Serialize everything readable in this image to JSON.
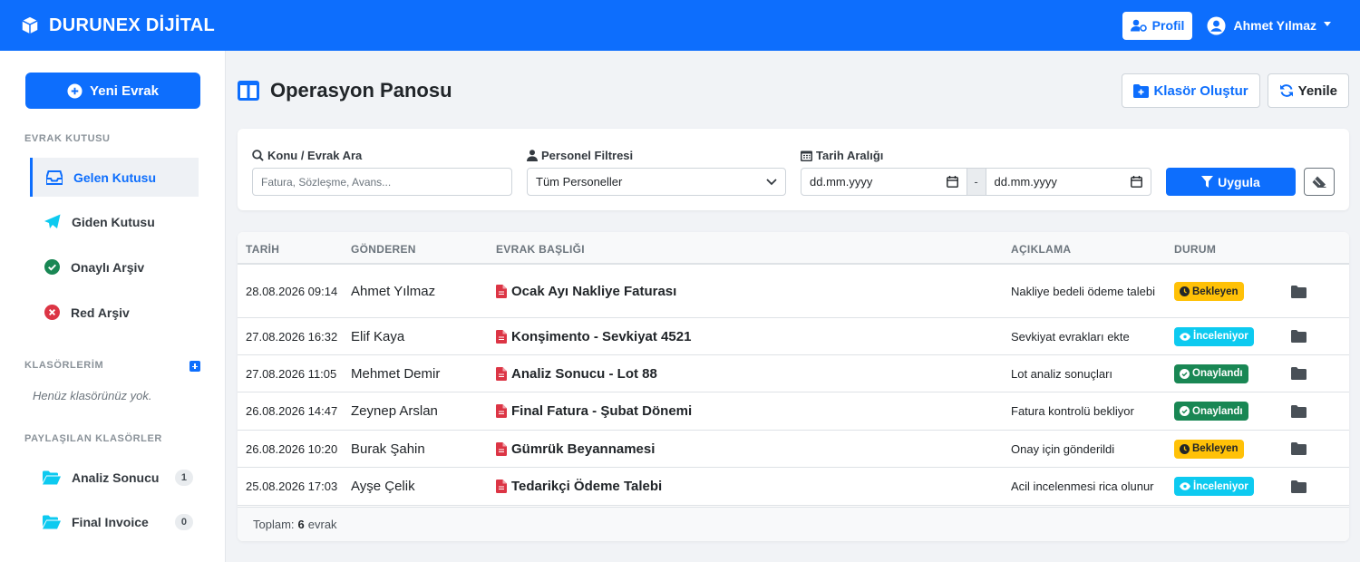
{
  "app": {
    "brand": "DURUNEX DİJİTAL"
  },
  "navbar": {
    "profile_label": "Profil",
    "user_name": "Ahmet Yılmaz"
  },
  "sidebar": {
    "new_doc_label": "Yeni Evrak",
    "inbox_title": "EVRAK KUTUSU",
    "items": [
      {
        "label": "Gelen Kutusu",
        "icon": "inbox-icon"
      },
      {
        "label": "Giden Kutusu",
        "icon": "paper-plane-icon"
      },
      {
        "label": "Onaylı Arşiv",
        "icon": "check-circle-icon"
      },
      {
        "label": "Red Arşiv",
        "icon": "x-circle-icon"
      }
    ],
    "folders_title": "KLASÖRLERİM",
    "folders_empty": "Henüz klasörünüz yok.",
    "shared_title": "PAYLAŞILAN KLASÖRLER",
    "shared": [
      {
        "label": "Analiz Sonucu",
        "count": "1"
      },
      {
        "label": "Final Invoice",
        "count": "0"
      }
    ]
  },
  "main": {
    "title": "Operasyon Panosu",
    "create_folder_label": "Klasör Oluştur",
    "refresh_label": "Yenile"
  },
  "filters": {
    "search_label": "Konu / Evrak Ara",
    "search_placeholder": "Fatura, Sözleşme, Avans...",
    "staff_label": "Personel Filtresi",
    "staff_value": "Tüm Personeller",
    "date_label": "Tarih Aralığı",
    "date_from": "dd.mm.yyyy",
    "date_sep": "-",
    "date_to": "dd.mm.yyyy",
    "apply_label": "Uygula"
  },
  "table": {
    "headers": {
      "date": "TARİH",
      "sender": "GÖNDEREN",
      "title": "EVRAK BAŞLIĞI",
      "desc": "AÇIKLAMA",
      "status": "DURUM"
    },
    "rows": [
      {
        "date": "28.08.2026 09:14",
        "sender": "Ahmet Yılmaz",
        "title": "Ocak Ayı Nakliye Faturası",
        "desc": "Nakliye bedeli ödeme talebi",
        "status": "Bekleyen"
      },
      {
        "date": "27.08.2026 16:32",
        "sender": "Elif Kaya",
        "title": "Konşimento - Sevkiyat 4521",
        "desc": "Sevkiyat evrakları ekte",
        "status": "İnceleniyor"
      },
      {
        "date": "27.08.2026 11:05",
        "sender": "Mehmet Demir",
        "title": "Analiz Sonucu - Lot 88",
        "desc": "Lot analiz sonuçları",
        "status": "Onaylandı"
      },
      {
        "date": "26.08.2026 14:47",
        "sender": "Zeynep Arslan",
        "title": "Final Fatura - Şubat Dönemi",
        "desc": "Fatura kontrolü bekliyor",
        "status": "Onaylandı"
      },
      {
        "date": "26.08.2026 10:20",
        "sender": "Burak Şahin",
        "title": "Gümrük Beyannamesi",
        "desc": "Onay için gönderildi",
        "status": "Bekleyen"
      },
      {
        "date": "25.08.2026 17:03",
        "sender": "Ayşe Çelik",
        "title": "Tedarikçi Ödeme Talebi",
        "desc": "Acil incelenmesi rica olunur",
        "status": "İnceleniyor"
      }
    ],
    "footer_label": "Toplam:",
    "footer_count": "6",
    "footer_unit": "evrak"
  },
  "colors": {
    "primary": "#0d6efd",
    "pending": "#ffc107",
    "review": "#0dcaf0",
    "approved": "#198754",
    "danger": "#dc3545"
  }
}
